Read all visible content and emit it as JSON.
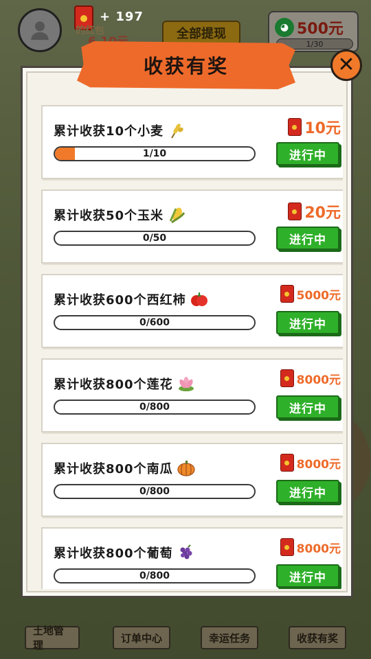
{
  "header": {
    "coin_gain": "+ 197",
    "redpack_label": "的红包",
    "redpack_amount": "6.10元",
    "withdraw_all": "全部提现",
    "wechat_amount": "500元",
    "wechat_progress": "1/30"
  },
  "modal": {
    "title": "收获有奖",
    "close_symbol": "✕",
    "tasks": [
      {
        "label": "累计收获10个小麦",
        "crop_icon": "wheat-icon",
        "progress_text": "1/10",
        "progress": 0.1,
        "reward": "10元",
        "status": "进行中"
      },
      {
        "label": "累计收获50个玉米",
        "crop_icon": "corn-icon",
        "progress_text": "0/50",
        "progress": 0,
        "reward": "20元",
        "status": "进行中"
      },
      {
        "label": "累计收获600个西红柿",
        "crop_icon": "tomato-icon",
        "progress_text": "0/600",
        "progress": 0,
        "reward": "5000元",
        "status": "进行中"
      },
      {
        "label": "累计收获800个莲花",
        "crop_icon": "lotus-icon",
        "progress_text": "0/800",
        "progress": 0,
        "reward": "8000元",
        "status": "进行中"
      },
      {
        "label": "累计收获800个南瓜",
        "crop_icon": "pumpkin-icon",
        "progress_text": "0/800",
        "progress": 0,
        "reward": "8000元",
        "status": "进行中"
      },
      {
        "label": "累计收获800个葡萄",
        "crop_icon": "grape-icon",
        "progress_text": "0/800",
        "progress": 0,
        "reward": "8000元",
        "status": "进行中"
      }
    ]
  },
  "bottom_nav": {
    "land": "土地管理",
    "orders": "订单中心",
    "luck": "幸运任务",
    "harvest": "收获有奖"
  },
  "colors": {
    "accent_orange": "#ee6a2a",
    "status_green": "#2fb02a",
    "redpack_red": "#d42a1e"
  }
}
